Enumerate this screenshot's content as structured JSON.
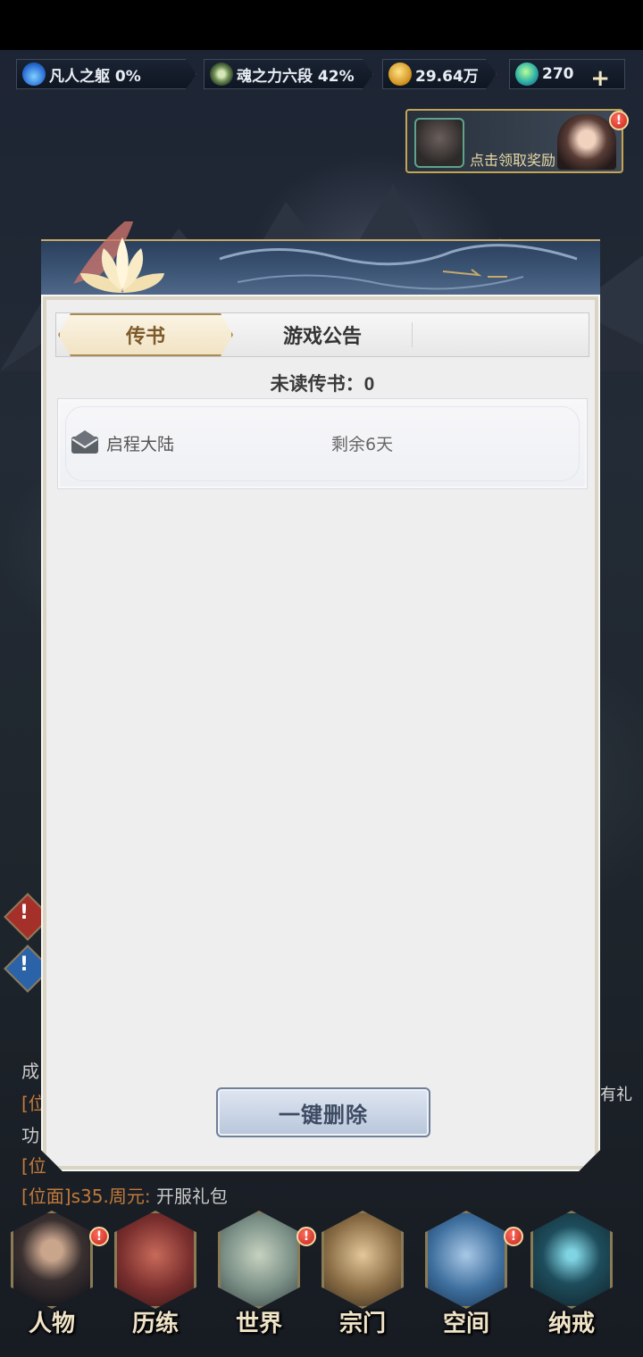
{
  "resources": [
    {
      "icon": "fire-icon",
      "text": "凡人之躯 0%"
    },
    {
      "icon": "soul-power-icon",
      "text": "魂之力六段 42%"
    },
    {
      "icon": "gold-coin-icon",
      "text": "29.64万"
    },
    {
      "icon": "gem-icon",
      "text": "270"
    }
  ],
  "plus_symbol": "+",
  "reward_banner": {
    "text": "点击领取奖励",
    "badge": "!"
  },
  "dialog": {
    "tabs": [
      {
        "label": "传书",
        "active": true
      },
      {
        "label": "游戏公告",
        "active": false
      }
    ],
    "unread_label": "未读传书：",
    "unread_count": "0",
    "mails": [
      {
        "title": "启程大陆",
        "remaining": "剩余6天",
        "icon": "envelope-icon"
      }
    ],
    "delete_all_label": "一键删除"
  },
  "side_alerts": [
    "!",
    "!"
  ],
  "chat": [
    {
      "tag": "",
      "text": "成"
    },
    {
      "tag": "[位",
      "text": ""
    },
    {
      "tag": "",
      "text": "功"
    },
    {
      "tag": "[位",
      "text": ""
    },
    {
      "tag": "[位面]s35.周元:",
      "text": " 开服礼包"
    }
  ],
  "right_gift_label": "有礼",
  "bottom_nav": [
    {
      "label": "人物",
      "badge": "!"
    },
    {
      "label": "历练",
      "badge": ""
    },
    {
      "label": "世界",
      "badge": "!"
    },
    {
      "label": "宗门",
      "badge": ""
    },
    {
      "label": "空间",
      "badge": "!"
    },
    {
      "label": "纳戒",
      "badge": ""
    }
  ],
  "colors": {
    "accent_gold": "#c4a554",
    "badge_red": "#c3271c",
    "tab_active_text": "#7d5a2a",
    "chat_tag": "#c27a3a"
  }
}
